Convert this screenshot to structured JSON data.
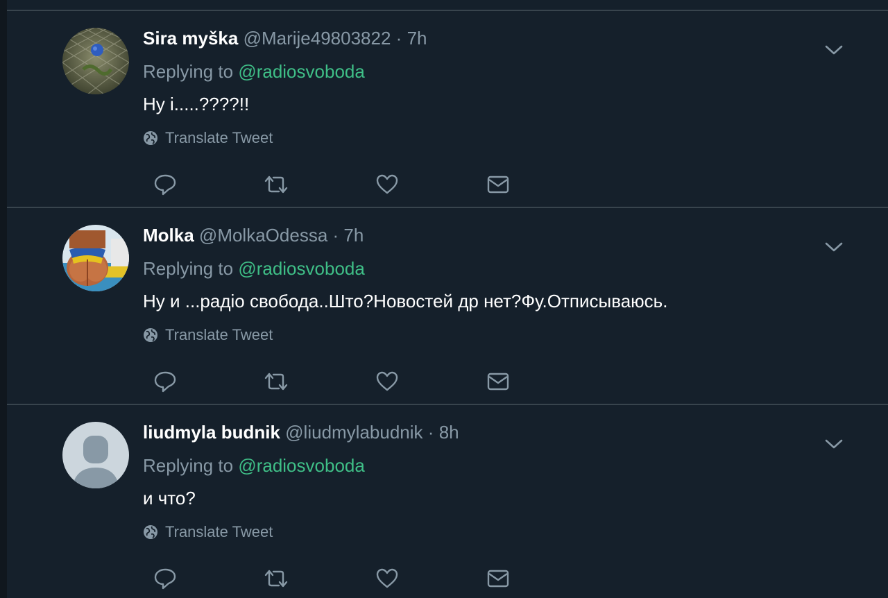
{
  "tweets": [
    {
      "name": "Sira myška",
      "handle": "@Marije49803822",
      "time": "7h",
      "replying_prefix": "Replying to",
      "replying_to": "@radiosvoboda",
      "text": "Ну і.....????!!",
      "translate": "Translate Tweet"
    },
    {
      "name": "Molka",
      "handle": "@MolkaOdessa",
      "time": "7h",
      "replying_prefix": "Replying to",
      "replying_to": "@radiosvoboda",
      "text": "Ну и ...радіо свобода..Што?Новостей др нет?Фу.Отписываюсь.",
      "translate": "Translate Tweet"
    },
    {
      "name": "liudmyla budnik",
      "handle": "@liudmylabudnik",
      "time": "8h",
      "replying_prefix": "Replying to",
      "replying_to": "@radiosvoboda",
      "text": "и что?",
      "translate": "Translate Tweet"
    }
  ],
  "separator": "·",
  "icons": {
    "reply": "reply-icon",
    "retweet": "retweet-icon",
    "like": "heart-icon",
    "dm": "envelope-icon",
    "caret": "chevron-down-icon",
    "globe": "globe-icon"
  },
  "colors": {
    "background": "#15202b",
    "divider": "#38444d",
    "muted": "#8899a6",
    "mention": "#3fbf87"
  }
}
